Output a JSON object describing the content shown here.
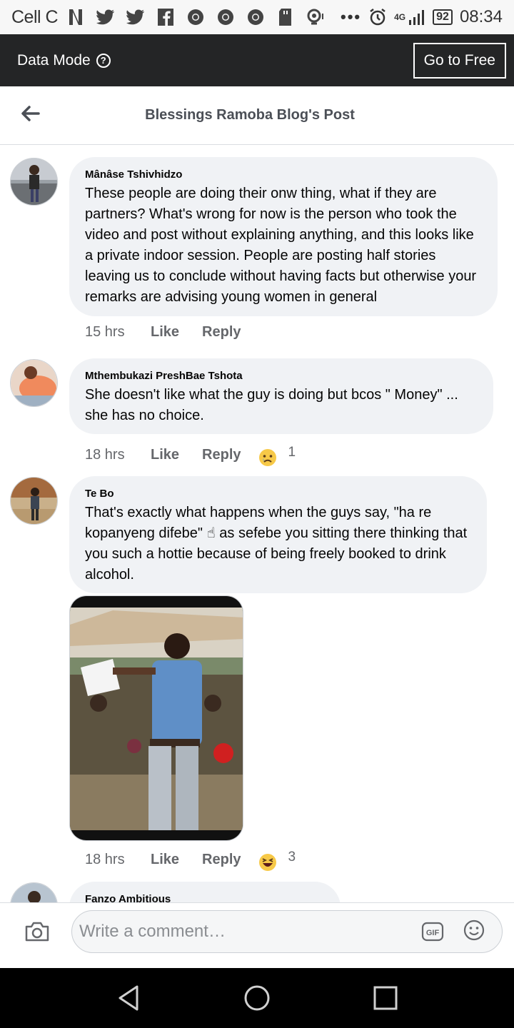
{
  "status_bar": {
    "carrier": "Cell C",
    "battery": "92",
    "network": "4G",
    "time": "08:34",
    "icons": [
      "netflix-icon",
      "twitter-icon",
      "twitter-icon",
      "facebook-icon",
      "chrome-icon",
      "chrome-icon",
      "chrome-icon",
      "sd-card-icon",
      "location-icon",
      "more-icon",
      "alarm-icon",
      "signal-icon",
      "battery-icon"
    ]
  },
  "data_mode_bar": {
    "label": "Data Mode",
    "help_icon": "?",
    "button": "Go to Free"
  },
  "header": {
    "title": "Blessings Ramoba Blog's Post"
  },
  "comments": [
    {
      "author": "Mânâse Tshivhidzo",
      "text": "These people are doing their onw thing, what if they are partners? What's wrong for now is the person who took the video and post without explaining anything, and this looks like a private indoor session. People are posting half stories leaving us to conclude without having facts but otherwise your remarks are advising young women in general",
      "time": "15 hrs",
      "like": "Like",
      "reply": "Reply"
    },
    {
      "author": "Mthembukazi PreshBae Tshota",
      "text": "She doesn't like what the guy is doing but bcos \" Money\" ... she has no choice.",
      "time": "18 hrs",
      "like": "Like",
      "reply": "Reply",
      "reaction": "sad",
      "reaction_count": "1"
    },
    {
      "author": "Te Bo",
      "text": "That's exactly what happens when the guys say, \"ha re kopanyeng difebe\" ☝ as sefebe you sitting there thinking that you such a hottie because of being freely booked to drink alcohol.",
      "time": "18 hrs",
      "like": "Like",
      "reply": "Reply",
      "reaction": "haha",
      "reaction_count": "3"
    },
    {
      "author": "Fanzo Ambitious"
    }
  ],
  "composer": {
    "placeholder": "Write a comment…",
    "gif_label": "GIF"
  },
  "colors": {
    "data_bar_bg": "#242526",
    "bubble_bg": "#f0f2f5",
    "meta_text": "#65676b"
  }
}
